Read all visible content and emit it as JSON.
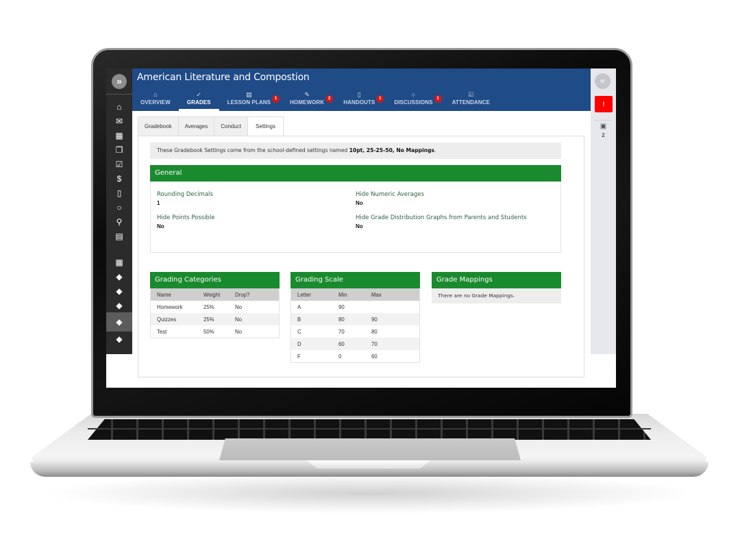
{
  "app": {
    "course_title": "American Literature and Compostion"
  },
  "left_rail": {
    "expand_icon": "»",
    "icons": [
      {
        "name": "home-icon",
        "glyph": "⌂"
      },
      {
        "name": "mail-icon",
        "glyph": "✉"
      },
      {
        "name": "calendar-icon",
        "glyph": "▦"
      },
      {
        "name": "documents-icon",
        "glyph": "❐"
      },
      {
        "name": "assignment-check-icon",
        "glyph": "☑"
      },
      {
        "name": "dollar-icon",
        "glyph": "$"
      },
      {
        "name": "file-icon",
        "glyph": "▯"
      },
      {
        "name": "chat-icon",
        "glyph": "○"
      },
      {
        "name": "search-icon",
        "glyph": "⚲"
      },
      {
        "name": "report-icon",
        "glyph": "▤"
      }
    ],
    "course_icons": [
      {
        "name": "grid-icon",
        "glyph": "▦"
      },
      {
        "name": "graduation-cap-icon",
        "glyph": "◆"
      },
      {
        "name": "graduation-cap-icon",
        "glyph": "◆"
      },
      {
        "name": "graduation-cap-icon",
        "glyph": "◆"
      },
      {
        "name": "graduation-cap-icon",
        "glyph": "◆",
        "active": true
      },
      {
        "name": "graduation-cap-icon",
        "glyph": "◆"
      }
    ]
  },
  "nav": {
    "tabs": [
      {
        "label": "OVERVIEW",
        "icon": "⌂",
        "badge": null
      },
      {
        "label": "GRADES",
        "icon": "✓",
        "badge": null,
        "active": true
      },
      {
        "label": "LESSON PLANS",
        "icon": "▤",
        "badge": "1"
      },
      {
        "label": "HOMEWORK",
        "icon": "✎",
        "badge": "2"
      },
      {
        "label": "HANDOUTS",
        "icon": "▯",
        "badge": "1"
      },
      {
        "label": "DISCUSSIONS",
        "icon": "○",
        "badge": "1"
      },
      {
        "label": "ATTENDANCE",
        "icon": "☑",
        "badge": null
      }
    ]
  },
  "right_panel": {
    "collapse_icon": "«",
    "alert_label": "!",
    "calendar_icon": "▣",
    "calendar_count": "2"
  },
  "subtabs": [
    {
      "label": "Gradebook"
    },
    {
      "label": "Averages"
    },
    {
      "label": "Conduct"
    },
    {
      "label": "Settings",
      "active": true
    }
  ],
  "info": {
    "prefix": "These Gradebook Settings come from the school-defined settings named ",
    "settings_name": "10pt, 25-25-50, No Mappings",
    "suffix": "."
  },
  "general": {
    "title": "General",
    "fields": [
      {
        "label": "Rounding Decimals",
        "value": "1"
      },
      {
        "label": "Hide Points Possible",
        "value": "No"
      },
      {
        "label": "Hide Numeric Averages",
        "value": "No"
      },
      {
        "label": "Hide Grade Distribution Graphs from Parents and Students",
        "value": "No"
      }
    ]
  },
  "grading_categories": {
    "title": "Grading Categories",
    "columns": [
      "Name",
      "Weight",
      "Drop?"
    ],
    "rows": [
      [
        "Homework",
        "25%",
        "No"
      ],
      [
        "Quizzes",
        "25%",
        "No"
      ],
      [
        "Test",
        "50%",
        "No"
      ]
    ]
  },
  "grading_scale": {
    "title": "Grading Scale",
    "columns": [
      "Letter",
      "Min",
      "Max"
    ],
    "rows": [
      [
        "A",
        "90",
        ""
      ],
      [
        "B",
        "80",
        "90"
      ],
      [
        "C",
        "70",
        "80"
      ],
      [
        "D",
        "60",
        "70"
      ],
      [
        "F",
        "0",
        "60"
      ]
    ]
  },
  "grade_mappings": {
    "title": "Grade Mappings",
    "empty_message": "There are no Grade Mappings."
  }
}
